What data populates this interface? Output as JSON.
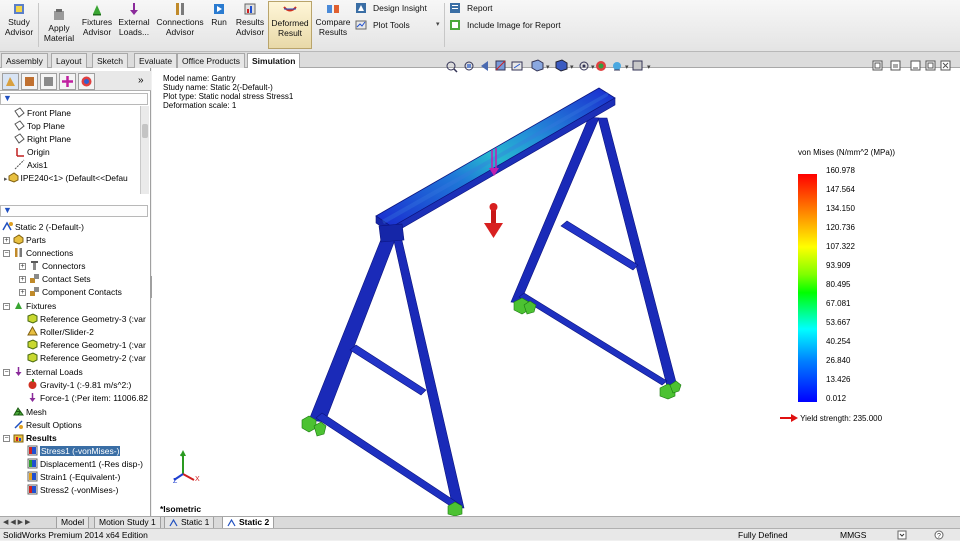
{
  "ribbon": {
    "buttons": [
      {
        "label": "Study\nAdvisor",
        "icon": "study-advisor-icon"
      },
      {
        "label": "Apply\nMaterial",
        "icon": "apply-material-icon"
      },
      {
        "label": "Fixtures\nAdvisor",
        "icon": "fixtures-advisor-icon"
      },
      {
        "label": "External\nLoads...",
        "icon": "external-loads-icon"
      },
      {
        "label": "Connections\nAdvisor",
        "icon": "connections-advisor-icon"
      },
      {
        "label": "Run",
        "icon": "run-icon"
      },
      {
        "label": "Results\nAdvisor",
        "icon": "results-advisor-icon"
      },
      {
        "label": "Deformed\nResult",
        "icon": "deformed-result-icon"
      },
      {
        "label": "Compare\nResults",
        "icon": "compare-results-icon"
      }
    ],
    "design_insight": "Design Insight",
    "plot_tools": "Plot Tools",
    "report": "Report",
    "include_image": "Include Image for Report"
  },
  "command_tabs": [
    "Assembly",
    "Layout",
    "Sketch",
    "Evaluate",
    "Office Products",
    "Simulation"
  ],
  "feature_tree": [
    {
      "label": "Front Plane",
      "icon": "plane-icon"
    },
    {
      "label": "Top Plane",
      "icon": "plane-icon"
    },
    {
      "label": "Right Plane",
      "icon": "plane-icon"
    },
    {
      "label": "Origin",
      "icon": "origin-icon"
    },
    {
      "label": "Axis1",
      "icon": "axis-icon"
    },
    {
      "label": "IPE240<1> (Default<<Defau",
      "icon": "part-icon"
    }
  ],
  "sim_tree": {
    "study": "Static 2 (-Default-)",
    "parts": "Parts",
    "connections": "Connections",
    "connectors": "Connectors",
    "contact_sets": "Contact Sets",
    "component_contacts": "Component Contacts",
    "fixtures": "Fixtures",
    "fixture_items": [
      "Reference Geometry-3 (:var",
      "Roller/Slider-2",
      "Reference Geometry-1 (:var",
      "Reference Geometry-2 (:var"
    ],
    "external_loads": "External Loads",
    "gravity": "Gravity-1 (:-9.81 m/s^2:)",
    "force": "Force-1 (:Per item: 11006.82",
    "mesh": "Mesh",
    "result_options": "Result Options",
    "results": "Results",
    "result_items": [
      "Stress1 (-vonMises-)",
      "Displacement1 (-Res disp-)",
      "Strain1 (-Equivalent-)",
      "Stress2 (-vonMises-)"
    ]
  },
  "viewport": {
    "info": [
      "Model name: Gantry",
      "Study name: Static 2(-Default-)",
      "Plot type: Static nodal stress Stress1",
      "Deformation scale: 1"
    ],
    "view_label": "*Isometric",
    "triad": {
      "x": "X",
      "y": "Y",
      "z": "Z"
    }
  },
  "legend": {
    "title": "von Mises (N/mm^2 (MPa))",
    "ticks": [
      "160.978",
      "147.564",
      "134.150",
      "120.736",
      "107.322",
      "93.909",
      "80.495",
      "67.081",
      "53.667",
      "40.254",
      "26.840",
      "13.426",
      "0.012"
    ],
    "yield": "Yield strength: 235.000",
    "yield_color": "#e01010"
  },
  "bottom_tabs": [
    "Model",
    "Motion Study 1",
    "Static 1",
    "Static 2"
  ],
  "status": {
    "app": "SolidWorks Premium 2014 x64 Edition",
    "state": "Fully Defined",
    "units": "MMGS"
  },
  "colors": {
    "beam": "#1a2ab8",
    "beam_dark": "#0c1480",
    "beam_light": "#3a52e0",
    "fixture": "#4cc232",
    "accent_select": "#3a6ea5"
  }
}
